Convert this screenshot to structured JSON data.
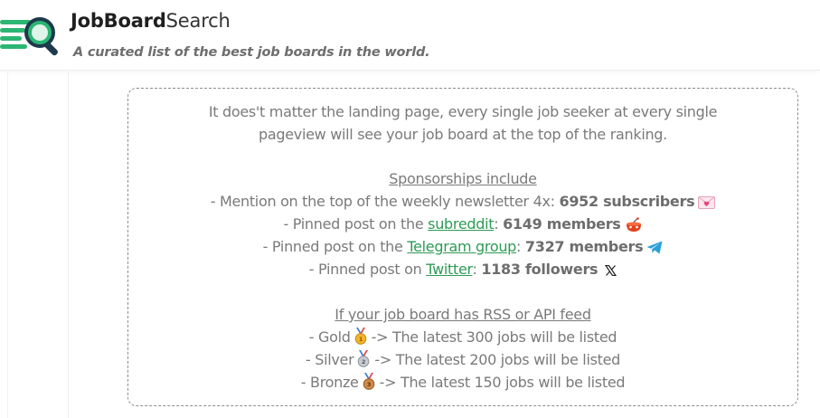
{
  "header": {
    "brand_part1": "JobBoard",
    "brand_part2": "Search",
    "tagline": "A curated list of the best job boards in the world."
  },
  "intro": {
    "line1": "It does't matter the landing page, every single job seeker at every single",
    "line2": "pageview will see your job board at the top of the ranking."
  },
  "sponsorships": {
    "heading": "Sponsorships include",
    "items": [
      {
        "prefix": "- Mention on the top of the weekly newsletter 4x: ",
        "link": "",
        "after": "",
        "stat": "6952 subscribers",
        "icon": "love-letter-icon"
      },
      {
        "prefix": "- Pinned post on the ",
        "link": "subreddit",
        "after": ": ",
        "stat": "6149 members",
        "icon": "reddit-icon"
      },
      {
        "prefix": "- Pinned post on the ",
        "link": "Telegram group",
        "after": ": ",
        "stat": "7327 members",
        "icon": "telegram-icon"
      },
      {
        "prefix": "- Pinned post on ",
        "link": "Twitter",
        "after": ": ",
        "stat": "1183 followers",
        "icon": "x-icon"
      }
    ]
  },
  "feeds": {
    "heading": "If your job board has RSS or API feed",
    "tiers": [
      {
        "name": "- Gold",
        "rest": "-> The latest 300 jobs will be listed",
        "medal": "1"
      },
      {
        "name": "- Silver",
        "rest": "-> The latest 200 jobs will be listed",
        "medal": "2"
      },
      {
        "name": "- Bronze",
        "rest": "-> The latest 150 jobs will be listed",
        "medal": "3"
      }
    ]
  },
  "colors": {
    "link": "#2e9b56",
    "text": "#7a7a7a",
    "logo_green": "#2bb673",
    "logo_dark": "#1e3a4c"
  }
}
